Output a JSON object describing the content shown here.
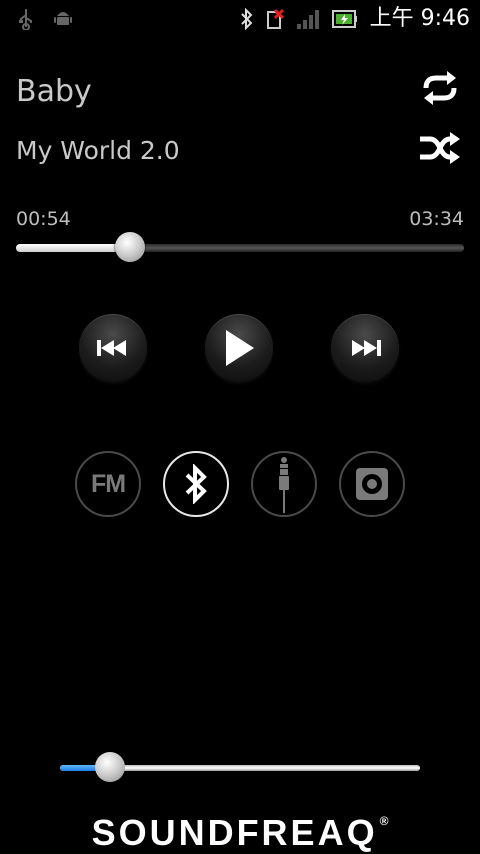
{
  "status_bar": {
    "time": "上午 9:46",
    "icons": [
      "usb-icon",
      "android-icon",
      "bluetooth-icon",
      "sim-error-icon",
      "signal-icon",
      "battery-icon"
    ]
  },
  "track": {
    "title": "Baby",
    "album": "My World 2.0",
    "elapsed": "00:54",
    "duration": "03:34",
    "progress_fraction": 0.254
  },
  "controls": {
    "repeat_icon": "repeat-icon",
    "shuffle_icon": "shuffle-icon",
    "prev_icon": "skip-previous-icon",
    "play_icon": "play-icon",
    "next_icon": "skip-next-icon"
  },
  "sources": {
    "fm_label": "FM",
    "active": "bluetooth",
    "items": [
      "fm",
      "bluetooth",
      "aux",
      "speaker"
    ]
  },
  "volume": {
    "level_fraction": 0.14,
    "accent": "#2a8cf0"
  },
  "brand": {
    "name": "SOUNDFREAQ",
    "mark": "®"
  }
}
